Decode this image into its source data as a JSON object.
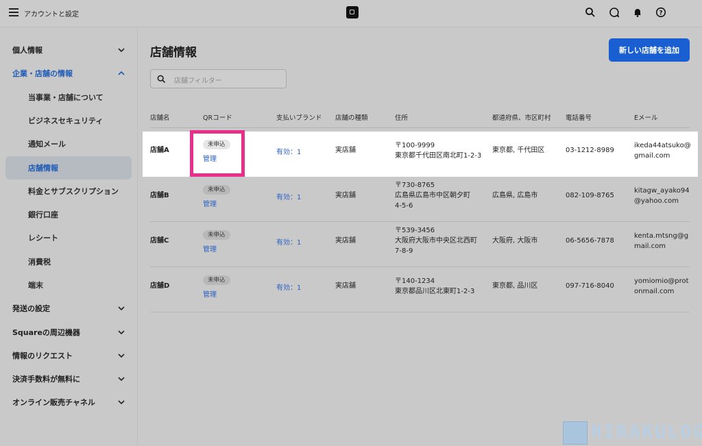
{
  "app": {
    "title": "アカウントと設定"
  },
  "sidebar": {
    "items": [
      {
        "label": "個人情報"
      },
      {
        "label": "企業・店舗の情報"
      },
      {
        "label": "当事業・店舗について"
      },
      {
        "label": "ビジネスセキュリティ"
      },
      {
        "label": "通知メール"
      },
      {
        "label": "店舗情報"
      },
      {
        "label": "料金とサブスクリプション"
      },
      {
        "label": "銀行口座"
      },
      {
        "label": "レシート"
      },
      {
        "label": "消費税"
      },
      {
        "label": "端末"
      },
      {
        "label": "発送の設定"
      },
      {
        "label": "Squareの周辺機器"
      },
      {
        "label": "情報のリクエスト"
      },
      {
        "label": "決済手数料が無料に"
      },
      {
        "label": "オンライン販売チャネル"
      }
    ]
  },
  "main": {
    "title": "店舗情報",
    "add_button": "新しい店舗を追加",
    "filter_placeholder": "店舗フィルター",
    "columns": [
      "店舗名",
      "QRコード",
      "支払いブランド",
      "店舗の種類",
      "住所",
      "都道府県、市区町村",
      "電話番号",
      "Eメール"
    ],
    "rows": [
      {
        "name": "店舗A",
        "qr_status": "未申込",
        "qr_link": "管理",
        "brand": "有効：1",
        "type": "実店舗",
        "address": [
          "〒100-9999",
          "東京都千代田区南北町1-2-3"
        ],
        "region": "東京都, 千代田区",
        "phone": "03-1212-8989",
        "email": [
          "ikeda44atsuko@",
          "gmail.com"
        ]
      },
      {
        "name": "店舗B",
        "qr_status": "未申込",
        "qr_link": "管理",
        "brand": "有効：1",
        "type": "実店舗",
        "address": [
          "〒730-8765",
          "広島県広島市中区朝夕町",
          "4-5-6"
        ],
        "region": "広島県, 広島市",
        "phone": "082-109-8765",
        "email": [
          "kitagw_ayako94",
          "@yahoo.com"
        ]
      },
      {
        "name": "店舗C",
        "qr_status": "未申込",
        "qr_link": "管理",
        "brand": "有効：1",
        "type": "実店舗",
        "address": [
          "〒539-3456",
          "大阪府大阪市中央区北西町",
          "7-8-9"
        ],
        "region": "大阪府, 大阪市",
        "phone": "06-5656-7878",
        "email": [
          "kenta.mtsng@g",
          "mail.com"
        ]
      },
      {
        "name": "店舗D",
        "qr_status": "未申込",
        "qr_link": "管理",
        "brand": "有効：1",
        "type": "実店舗",
        "address": [
          "〒140-1234",
          "東京都品川区北東町1-2-3"
        ],
        "region": "東京都, 品川区",
        "phone": "097-716-8040",
        "email": [
          "yomiomio@prot",
          "onmail.com"
        ]
      }
    ]
  },
  "watermark": {
    "text": "HIRAKULOG"
  },
  "colors": {
    "accent": "#1a5fd1",
    "link": "#2a61c2",
    "highlight_box": "#e8308a"
  }
}
